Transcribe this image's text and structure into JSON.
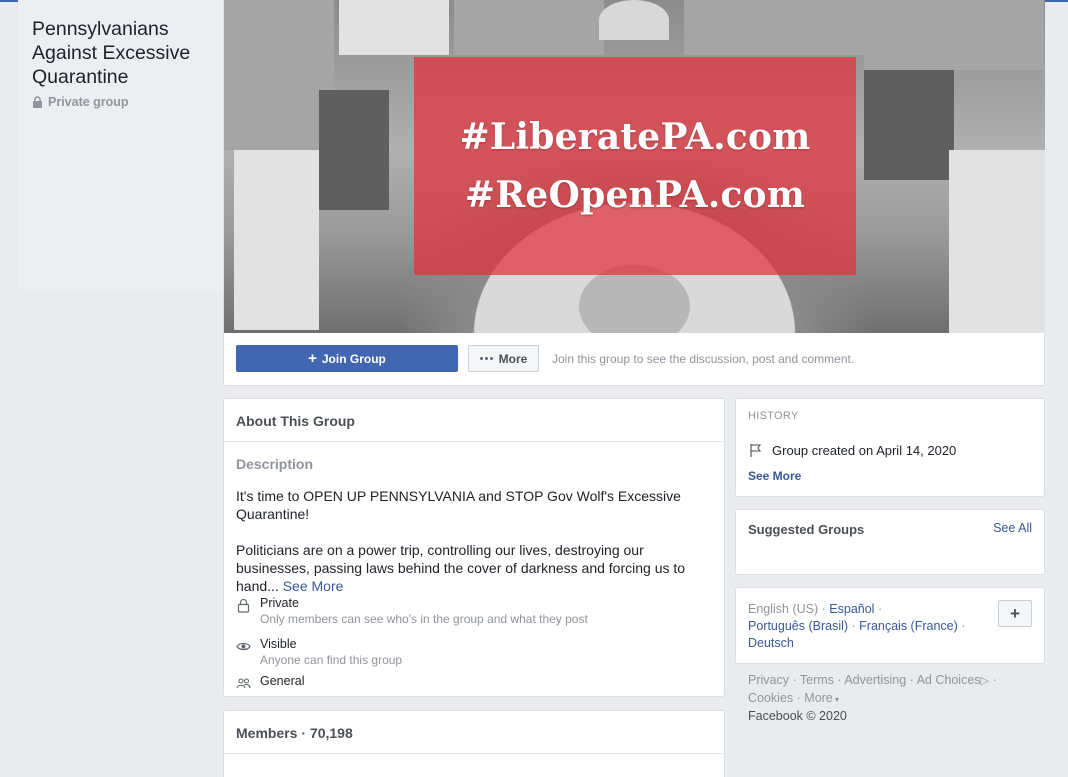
{
  "group": {
    "name": "Pennsylvanians Against Excessive Quarantine",
    "privacy": "Private group"
  },
  "cover": {
    "line1": "#LiberatePA.com",
    "line2": "#ReOpenPA.com",
    "banner_color": "#e2303a"
  },
  "actions": {
    "join_label": "Join Group",
    "join_plus": "+",
    "more_label": "More",
    "hint": "Join this group to see the discussion, post and comment."
  },
  "about": {
    "heading": "About This Group",
    "description_label": "Description",
    "paragraph1": "It's time to OPEN UP PENNSYLVANIA and STOP Gov Wolf's Excessive Quarantine!",
    "paragraph2": "Politicians are on a power trip, controlling our lives, destroying our businesses, passing laws behind the cover of darkness and forcing us to hand...",
    "see_more": "See More",
    "private_title": "Private",
    "private_sub": "Only members can see who's in the group and what they post",
    "visible_title": "Visible",
    "visible_sub": "Anyone can find this group",
    "category": "General"
  },
  "members": {
    "heading": "Members · 70,198"
  },
  "history": {
    "heading": "HISTORY",
    "created": "Group created on April 14, 2020",
    "see_more": "See More"
  },
  "suggested": {
    "heading": "Suggested Groups",
    "see_all": "See All"
  },
  "languages": {
    "current": "English (US)",
    "espanol": "Español",
    "portugues": "Português (Brasil)",
    "francais": "Français (France)",
    "deutsch": "Deutsch",
    "add": "+"
  },
  "footer": {
    "privacy": "Privacy",
    "terms": "Terms",
    "advertising": "Advertising",
    "ad_choices": "Ad Choices",
    "cookies": "Cookies",
    "more": "More",
    "copyright": "Facebook © 2020"
  },
  "colors": {
    "brand_blue": "#4267b2",
    "link_blue": "#385898",
    "page_bg": "#e9ebee"
  }
}
